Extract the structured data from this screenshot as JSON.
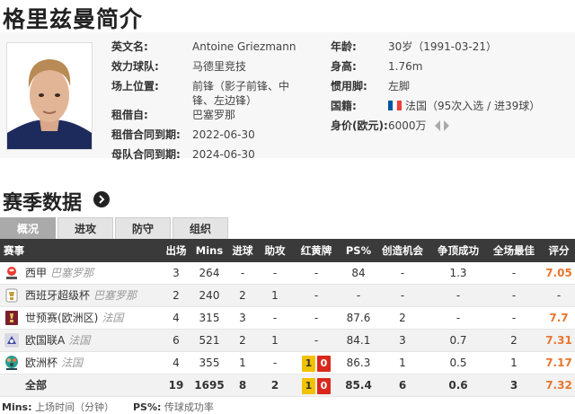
{
  "page_title": "格里兹曼简介",
  "profile": {
    "left": [
      {
        "label": "英文名:",
        "value": "Antoine Griezmann"
      },
      {
        "label": "效力球队:",
        "value": "马德里竞技"
      },
      {
        "label": "场上位置:",
        "value": "前锋（影子前锋、中",
        "value2": "锋、左边锋）"
      },
      {
        "label": "租借自:",
        "value": "巴塞罗那"
      },
      {
        "label": "租借合同到期:",
        "value": "2022-06-30"
      },
      {
        "label": "母队合同到期:",
        "value": "2024-06-30"
      }
    ],
    "right": [
      {
        "label": "年龄:",
        "value": "30岁（1991-03-21）"
      },
      {
        "label": "身高:",
        "value": "1.76m"
      },
      {
        "label": "惯用脚:",
        "value": "左脚"
      },
      {
        "label": "国籍:",
        "value": "法国（95次入选 / 进39球）"
      },
      {
        "label": "身价(欧元):",
        "value": "6000万"
      }
    ],
    "flag_colors": [
      "#0055a4",
      "#ffffff",
      "#ef4135"
    ]
  },
  "section_title": "赛季数据",
  "tabs": [
    {
      "label": "概况",
      "active": true
    },
    {
      "label": "进攻",
      "active": false
    },
    {
      "label": "防守",
      "active": false
    },
    {
      "label": "组织",
      "active": false
    }
  ],
  "table": {
    "headers": [
      "赛事",
      "出场",
      "Mins",
      "进球",
      "助攻",
      "红黄牌",
      "PS%",
      "创造机会",
      "争顶成功",
      "全场最佳",
      "评分"
    ],
    "rows": [
      {
        "comp": "西甲",
        "team": "巴塞罗那",
        "apps": "3",
        "mins": "264",
        "goals": "-",
        "assists": "-",
        "cards": "-",
        "ps": "84",
        "chances": "-",
        "aerial": "1.3",
        "motm": "-",
        "rating": "7.05",
        "logo": "laliga"
      },
      {
        "comp": "西班牙超级杯",
        "team": "巴塞罗那",
        "apps": "2",
        "mins": "240",
        "goals": "2",
        "assists": "1",
        "cards": "-",
        "ps": "-",
        "chances": "-",
        "aerial": "-",
        "motm": "-",
        "rating": "-",
        "logo": "supercopa"
      },
      {
        "comp": "世预赛(欧洲区)",
        "team": "法国",
        "apps": "4",
        "mins": "315",
        "goals": "3",
        "assists": "-",
        "cards": "-",
        "ps": "87.6",
        "chances": "2",
        "aerial": "-",
        "motm": "-",
        "rating": "7.7",
        "logo": "wcq"
      },
      {
        "comp": "欧国联A",
        "team": "法国",
        "apps": "6",
        "mins": "521",
        "goals": "2",
        "assists": "1",
        "cards": "-",
        "ps": "84.1",
        "chances": "3",
        "aerial": "0.7",
        "motm": "2",
        "rating": "7.31",
        "logo": "nations"
      },
      {
        "comp": "欧洲杯",
        "team": "法国",
        "apps": "4",
        "mins": "355",
        "goals": "1",
        "assists": "-",
        "yellow": "1",
        "red": "0",
        "ps": "86.3",
        "chances": "1",
        "aerial": "0.5",
        "motm": "1",
        "rating": "7.17",
        "logo": "euro"
      }
    ],
    "total": {
      "label": "全部",
      "apps": "19",
      "mins": "1695",
      "goals": "8",
      "assists": "2",
      "yellow": "1",
      "red": "0",
      "ps": "85.4",
      "chances": "6",
      "aerial": "0.6",
      "motm": "3",
      "rating": "7.32"
    }
  },
  "footer": {
    "mins_label": "Mins:",
    "mins_desc": "上场时间（分钟）",
    "ps_label": "PS%:",
    "ps_desc": "传球成功率"
  }
}
